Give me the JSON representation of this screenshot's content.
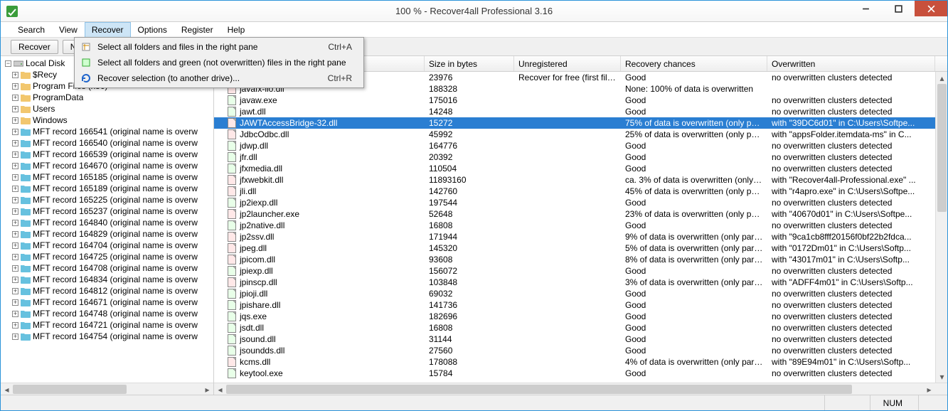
{
  "title": "100 % - Recover4all Professional 3.16",
  "menus": [
    "Search",
    "View",
    "Recover",
    "Options",
    "Register",
    "Help"
  ],
  "menu_open_index": 2,
  "dropdown": [
    {
      "label": "Select all folders and files in the right pane",
      "shortcut": "Ctrl+A",
      "icon": "select-all"
    },
    {
      "label": "Select all folders and green (not overwritten) files in the right pane",
      "shortcut": "",
      "icon": "select-green"
    },
    {
      "label": "Recover selection (to another drive)...",
      "shortcut": "Ctrl+R",
      "icon": "recover"
    }
  ],
  "toolbar": {
    "recover": "Recover",
    "drive": "N1"
  },
  "tree": {
    "root": "Local Disk",
    "folders": [
      "$Recy",
      "Program Files (x86)",
      "ProgramData",
      "Users",
      "Windows"
    ],
    "mft": [
      "MFT record 166541 (original name is overw",
      "MFT record 166540 (original name is overw",
      "MFT record 166539 (original name is overw",
      "MFT record 164670 (original name is overw",
      "MFT record 165185 (original name is overw",
      "MFT record 165189 (original name is overw",
      "MFT record 165225 (original name is overw",
      "MFT record 165237 (original name is overw",
      "MFT record 164840 (original name is overw",
      "MFT record 164829 (original name is overw",
      "MFT record 164704 (original name is overw",
      "MFT record 164725 (original name is overw",
      "MFT record 164708 (original name is overw",
      "MFT record 164834 (original name is overw",
      "MFT record 164812 (original name is overw",
      "MFT record 164671 (original name is overw",
      "MFT record 164748 (original name is overw",
      "MFT record 164721 (original name is overw",
      "MFT record 164754 (original name is overw"
    ]
  },
  "columns": {
    "name": "",
    "size": "Size in bytes",
    "unreg": "Unregistered",
    "rec": "Recovery chances",
    "over": "Overwritten"
  },
  "files": [
    {
      "name": "",
      "size": "23976",
      "unreg": "Recover for free (first file...",
      "rec": "Good",
      "over": "no overwritten clusters detected",
      "red": false
    },
    {
      "name": "javafx-iio.dll",
      "size": "188328",
      "unreg": "",
      "rec": "None: 100% of data is overwritten",
      "over": "",
      "red": true
    },
    {
      "name": "javaw.exe",
      "size": "175016",
      "unreg": "",
      "rec": "Good",
      "over": "no overwritten clusters detected",
      "red": false
    },
    {
      "name": "jawt.dll",
      "size": "14248",
      "unreg": "",
      "rec": "Good",
      "over": "no overwritten clusters detected",
      "red": false
    },
    {
      "name": "JAWTAccessBridge-32.dll",
      "size": "15272",
      "unreg": "",
      "rec": "75% of data is overwritten (only par...",
      "over": "with \"39DC6d01\" in C:\\Users\\Softpe...",
      "selected": true,
      "red": true
    },
    {
      "name": "JdbcOdbc.dll",
      "size": "45992",
      "unreg": "",
      "rec": "25% of data is overwritten (only par...",
      "over": "with \"appsFolder.itemdata-ms\" in C...",
      "red": true
    },
    {
      "name": "jdwp.dll",
      "size": "164776",
      "unreg": "",
      "rec": "Good",
      "over": "no overwritten clusters detected",
      "red": false
    },
    {
      "name": "jfr.dll",
      "size": "20392",
      "unreg": "",
      "rec": "Good",
      "over": "no overwritten clusters detected",
      "red": false
    },
    {
      "name": "jfxmedia.dll",
      "size": "110504",
      "unreg": "",
      "rec": "Good",
      "over": "no overwritten clusters detected",
      "red": false
    },
    {
      "name": "jfxwebkit.dll",
      "size": "11893160",
      "unreg": "",
      "rec": "ca. 3% of data is overwritten (only p...",
      "over": "with \"Recover4all-Professional.exe\" ...",
      "red": true
    },
    {
      "name": "jli.dll",
      "size": "142760",
      "unreg": "",
      "rec": "45% of data is overwritten (only par...",
      "over": "with \"r4apro.exe\" in C:\\Users\\Softpe...",
      "red": true
    },
    {
      "name": "jp2iexp.dll",
      "size": "197544",
      "unreg": "",
      "rec": "Good",
      "over": "no overwritten clusters detected",
      "red": false
    },
    {
      "name": "jp2launcher.exe",
      "size": "52648",
      "unreg": "",
      "rec": "23% of data is overwritten (only par...",
      "over": "with \"40670d01\" in C:\\Users\\Softpe...",
      "red": true
    },
    {
      "name": "jp2native.dll",
      "size": "16808",
      "unreg": "",
      "rec": "Good",
      "over": "no overwritten clusters detected",
      "red": false
    },
    {
      "name": "jp2ssv.dll",
      "size": "171944",
      "unreg": "",
      "rec": "9% of data is overwritten (only parti...",
      "over": "with \"9ca1cb8fff20156f0bf22b2fdca...",
      "red": true
    },
    {
      "name": "jpeg.dll",
      "size": "145320",
      "unreg": "",
      "rec": "5% of data is overwritten (only parti...",
      "over": "with \"0172Dm01\" in C:\\Users\\Softp...",
      "red": true
    },
    {
      "name": "jpicom.dll",
      "size": "93608",
      "unreg": "",
      "rec": "8% of data is overwritten (only parti...",
      "over": "with \"43017m01\" in C:\\Users\\Softp...",
      "red": true
    },
    {
      "name": "jpiexp.dll",
      "size": "156072",
      "unreg": "",
      "rec": "Good",
      "over": "no overwritten clusters detected",
      "red": false
    },
    {
      "name": "jpinscp.dll",
      "size": "103848",
      "unreg": "",
      "rec": "3% of data is overwritten (only parti...",
      "over": "with \"ADFF4m01\" in C:\\Users\\Softp...",
      "red": true
    },
    {
      "name": "jpioji.dll",
      "size": "69032",
      "unreg": "",
      "rec": "Good",
      "over": "no overwritten clusters detected",
      "red": false
    },
    {
      "name": "jpishare.dll",
      "size": "141736",
      "unreg": "",
      "rec": "Good",
      "over": "no overwritten clusters detected",
      "red": false
    },
    {
      "name": "jqs.exe",
      "size": "182696",
      "unreg": "",
      "rec": "Good",
      "over": "no overwritten clusters detected",
      "red": false
    },
    {
      "name": "jsdt.dll",
      "size": "16808",
      "unreg": "",
      "rec": "Good",
      "over": "no overwritten clusters detected",
      "red": false
    },
    {
      "name": "jsound.dll",
      "size": "31144",
      "unreg": "",
      "rec": "Good",
      "over": "no overwritten clusters detected",
      "red": false
    },
    {
      "name": "jsoundds.dll",
      "size": "27560",
      "unreg": "",
      "rec": "Good",
      "over": "no overwritten clusters detected",
      "red": false
    },
    {
      "name": "kcms.dll",
      "size": "178088",
      "unreg": "",
      "rec": "4% of data is overwritten (only parti...",
      "over": "with \"89E94m01\" in C:\\Users\\Softp...",
      "red": true
    },
    {
      "name": "keytool.exe",
      "size": "15784",
      "unreg": "",
      "rec": "Good",
      "over": "no overwritten clusters detected",
      "red": false
    }
  ],
  "status": {
    "num": "NUM"
  }
}
